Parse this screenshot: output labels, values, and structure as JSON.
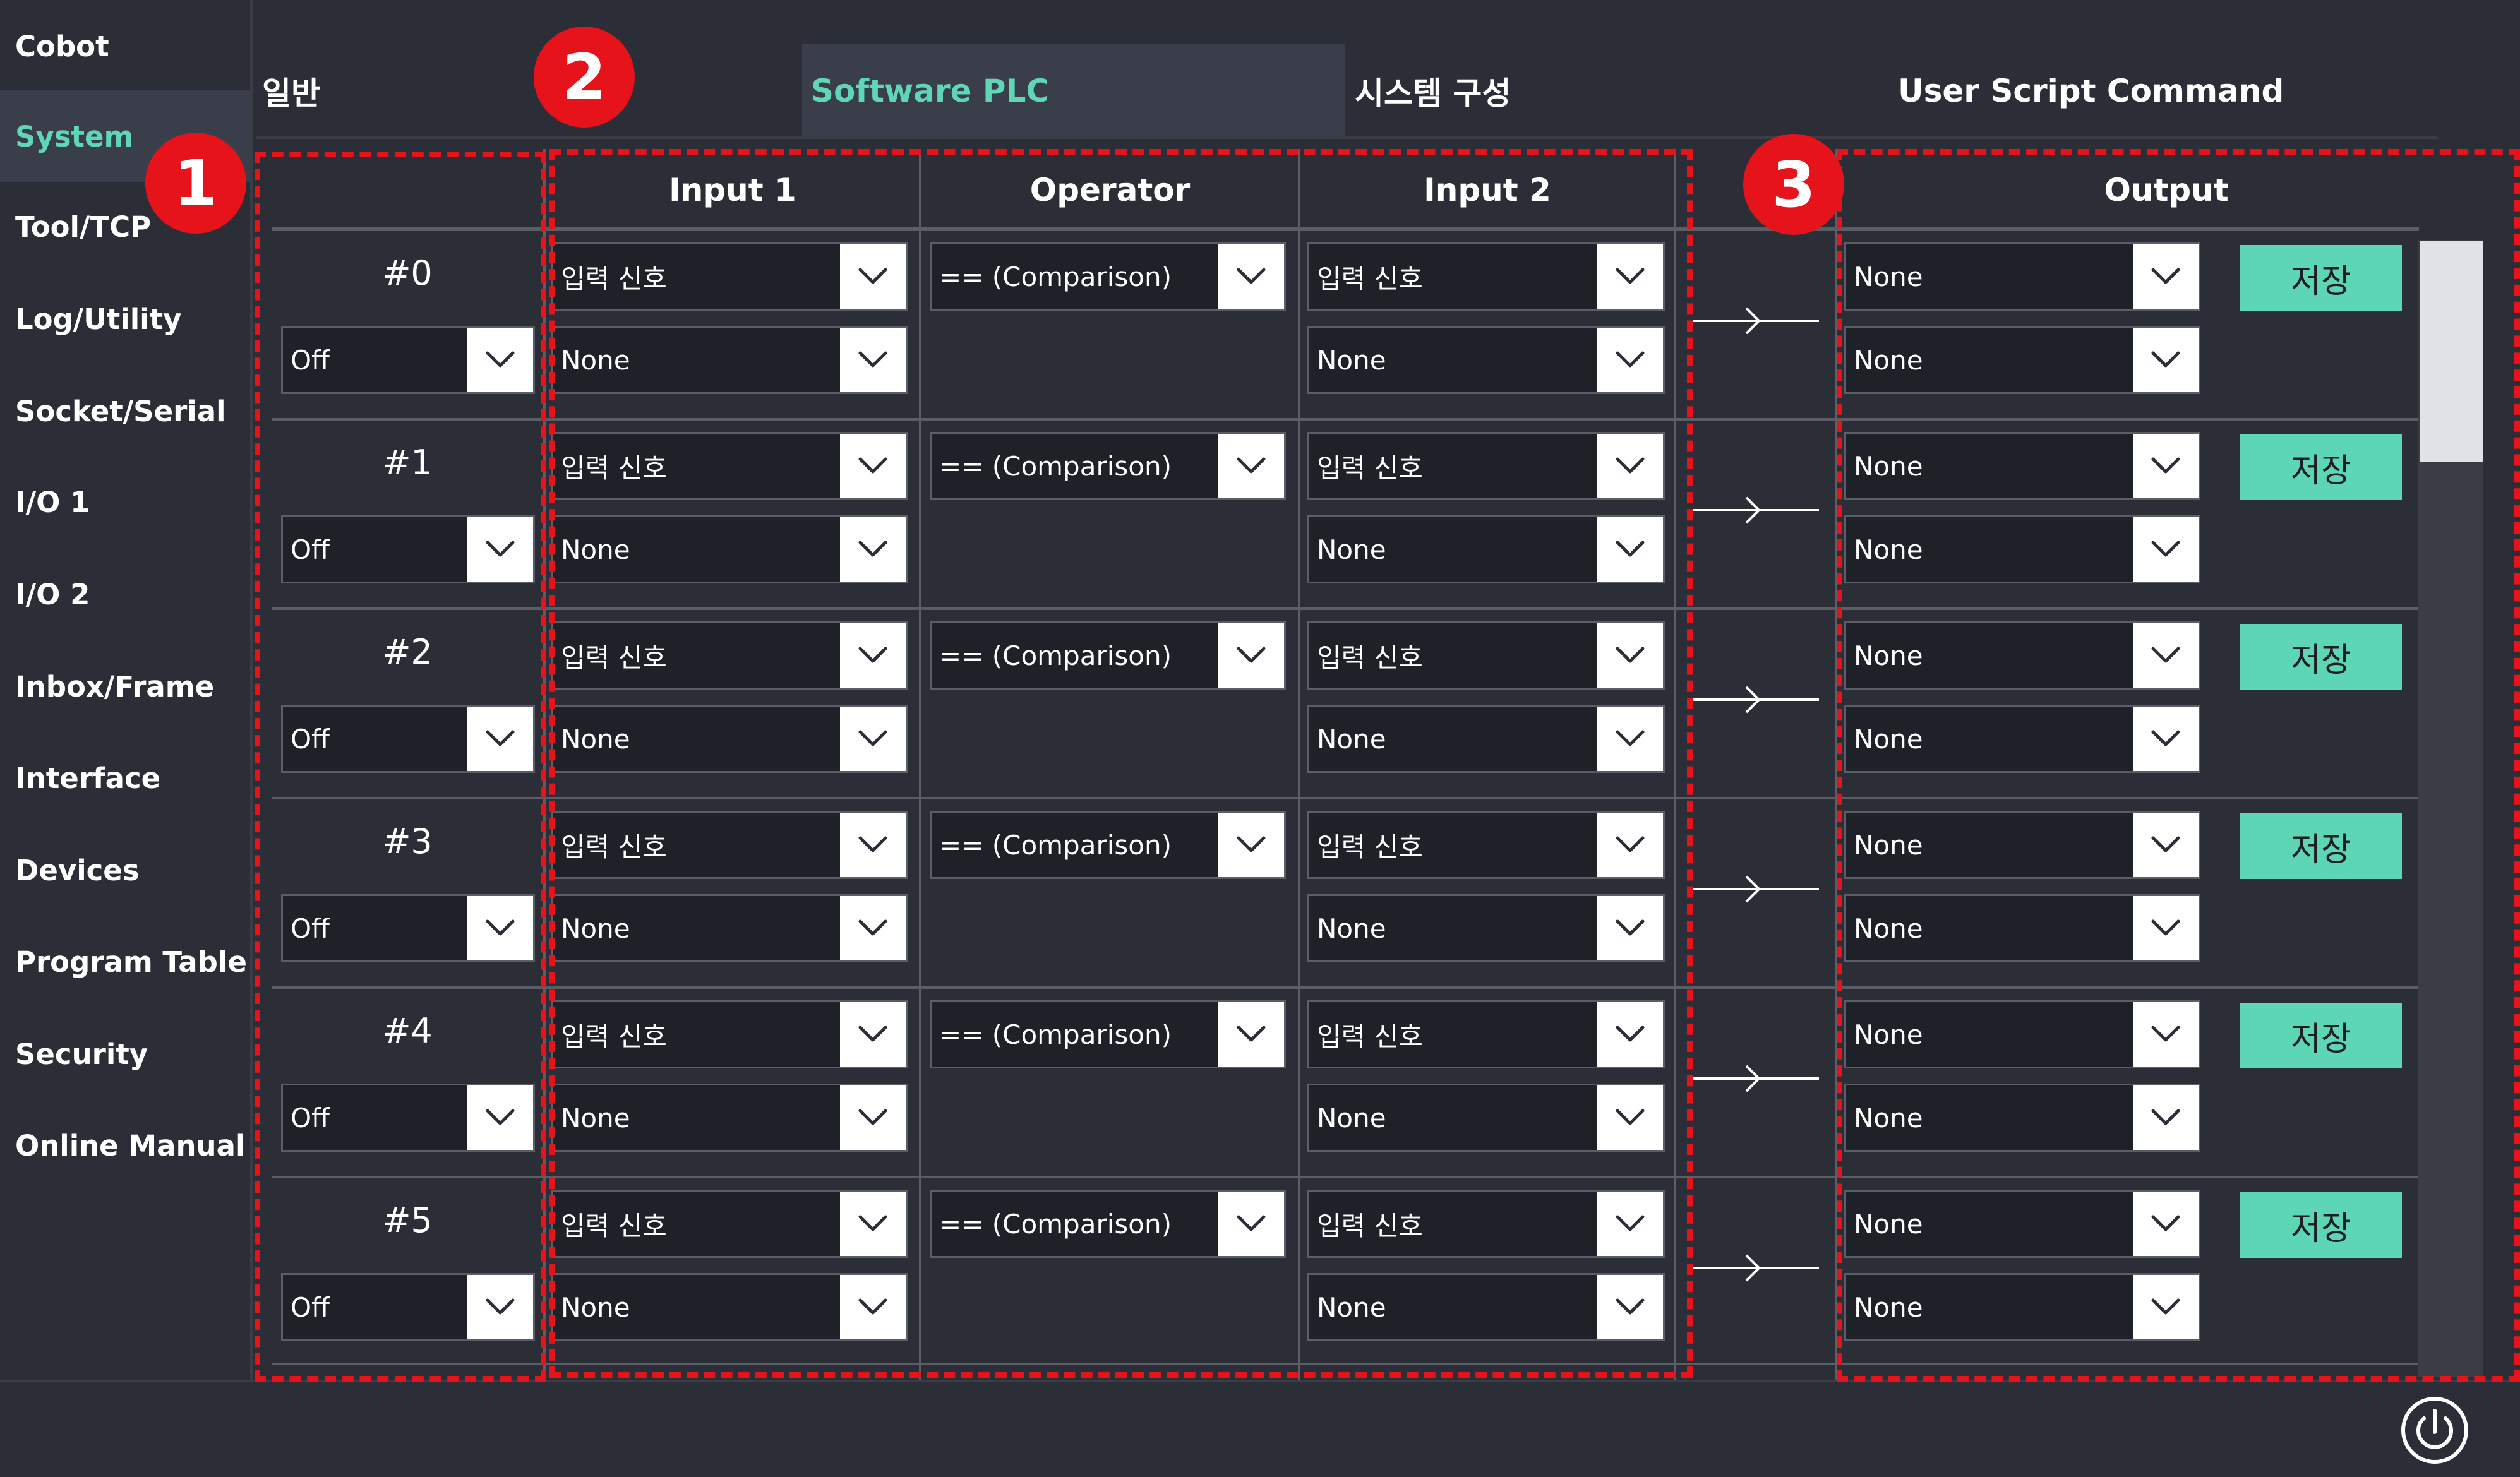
{
  "sidebar": {
    "items": [
      {
        "label": "Cobot"
      },
      {
        "label": "System",
        "active": true
      },
      {
        "label": "Tool/TCP"
      },
      {
        "label": "Log/Utility"
      },
      {
        "label": "Socket/Serial"
      },
      {
        "label": "I/O 1"
      },
      {
        "label": "I/O 2"
      },
      {
        "label": "Inbox/Frame"
      },
      {
        "label": "Interface"
      },
      {
        "label": "Devices"
      },
      {
        "label": "Program Table"
      },
      {
        "label": "Security"
      },
      {
        "label": "Online Manual"
      }
    ]
  },
  "tabs": [
    {
      "label": "일반"
    },
    {
      "label": "Software PLC",
      "active": true
    },
    {
      "label": "시스템 구성"
    },
    {
      "label": "User Script Command"
    }
  ],
  "table": {
    "headers": {
      "input1": "Input 1",
      "operator": "Operator",
      "input2": "Input 2",
      "output": "Output"
    },
    "rows": [
      {
        "id": "#0",
        "enable": "Off",
        "input1_type": "입력 신호",
        "input1_value": "None",
        "operator": "== (Comparison)",
        "input2_type": "입력 신호",
        "input2_value": "None",
        "output_top": "None",
        "output_bottom": "None",
        "save": "저장"
      },
      {
        "id": "#1",
        "enable": "Off",
        "input1_type": "입력 신호",
        "input1_value": "None",
        "operator": "== (Comparison)",
        "input2_type": "입력 신호",
        "input2_value": "None",
        "output_top": "None",
        "output_bottom": "None",
        "save": "저장"
      },
      {
        "id": "#2",
        "enable": "Off",
        "input1_type": "입력 신호",
        "input1_value": "None",
        "operator": "== (Comparison)",
        "input2_type": "입력 신호",
        "input2_value": "None",
        "output_top": "None",
        "output_bottom": "None",
        "save": "저장"
      },
      {
        "id": "#3",
        "enable": "Off",
        "input1_type": "입력 신호",
        "input1_value": "None",
        "operator": "== (Comparison)",
        "input2_type": "입력 신호",
        "input2_value": "None",
        "output_top": "None",
        "output_bottom": "None",
        "save": "저장"
      },
      {
        "id": "#4",
        "enable": "Off",
        "input1_type": "입력 신호",
        "input1_value": "None",
        "operator": "== (Comparison)",
        "input2_type": "입력 신호",
        "input2_value": "None",
        "output_top": "None",
        "output_bottom": "None",
        "save": "저장"
      },
      {
        "id": "#5",
        "enable": "Off",
        "input1_type": "입력 신호",
        "input1_value": "None",
        "operator": "== (Comparison)",
        "input2_type": "입력 신호",
        "input2_value": "None",
        "output_top": "None",
        "output_bottom": "None",
        "save": "저장"
      }
    ]
  },
  "annotations": {
    "badge1": "1",
    "badge2": "2",
    "badge3": "3"
  },
  "colors": {
    "accent": "#5fd7b6",
    "save_button": "#5cd6b5",
    "annotation_red": "#e6141a",
    "background": "#2b2e37"
  },
  "icons": {
    "dropdown": "chevron-down-icon",
    "arrow": "arrow-right-icon",
    "power": "power-icon"
  }
}
